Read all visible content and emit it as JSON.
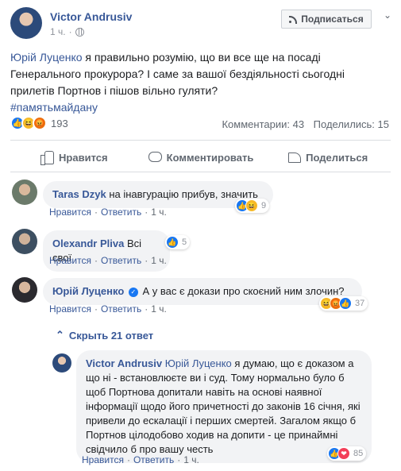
{
  "post": {
    "author": "Victor Andrusiv",
    "time": "1 ч.",
    "subscribe_label": "Подписаться",
    "text_mention": "Юрій Луценко",
    "text_body": " я правильно розумію, що ви все ще на посаді Генерального прокурора? І саме за вашої бездіяльності сьогодні прилетів Портнов і пішов вільно гуляти?",
    "hashtag": "#памятьмайдану",
    "reaction_count": "193",
    "comments_count": "Комментарии: 43",
    "shares_count": "Поделились: 15"
  },
  "actions": {
    "like": "Нравится",
    "comment": "Комментировать",
    "share": "Поделиться"
  },
  "comments": [
    {
      "name": "Taras Dzyk",
      "text": "на інавгурацію прибув, значить",
      "like": "Нравится",
      "reply": "Ответить",
      "time": "1 ч.",
      "reactions": "9"
    },
    {
      "name": "Olexandr Pliva",
      "text": "Всі свої",
      "like": "Нравится",
      "reply": "Ответить",
      "time": "1 ч.",
      "reactions": "5"
    },
    {
      "name": "Юрій Луценко",
      "text": "А у вас є докази про скоєний ним злочин?",
      "like": "Нравится",
      "reply": "Ответить",
      "time": "1 ч.",
      "reactions": "37"
    }
  ],
  "hide_replies": "Скрыть 21 ответ",
  "reply": {
    "name": "Victor Andrusiv",
    "mention": "Юрій Луценко",
    "text": " я думаю, що є доказом а що ні - встановлюєте ви і суд. Тому нормально було б щоб Портнова допитали навіть на основі наявної інформації щодо його причетності до законів 16 січня, які привели до ескалації і перших смертей. Загалом якщо б Портнов цілодобово ходив на допити - це принаймні свідчило б про вашу честь",
    "like": "Нравится",
    "reply": "Ответить",
    "time": "1 ч.",
    "reactions": "85"
  }
}
